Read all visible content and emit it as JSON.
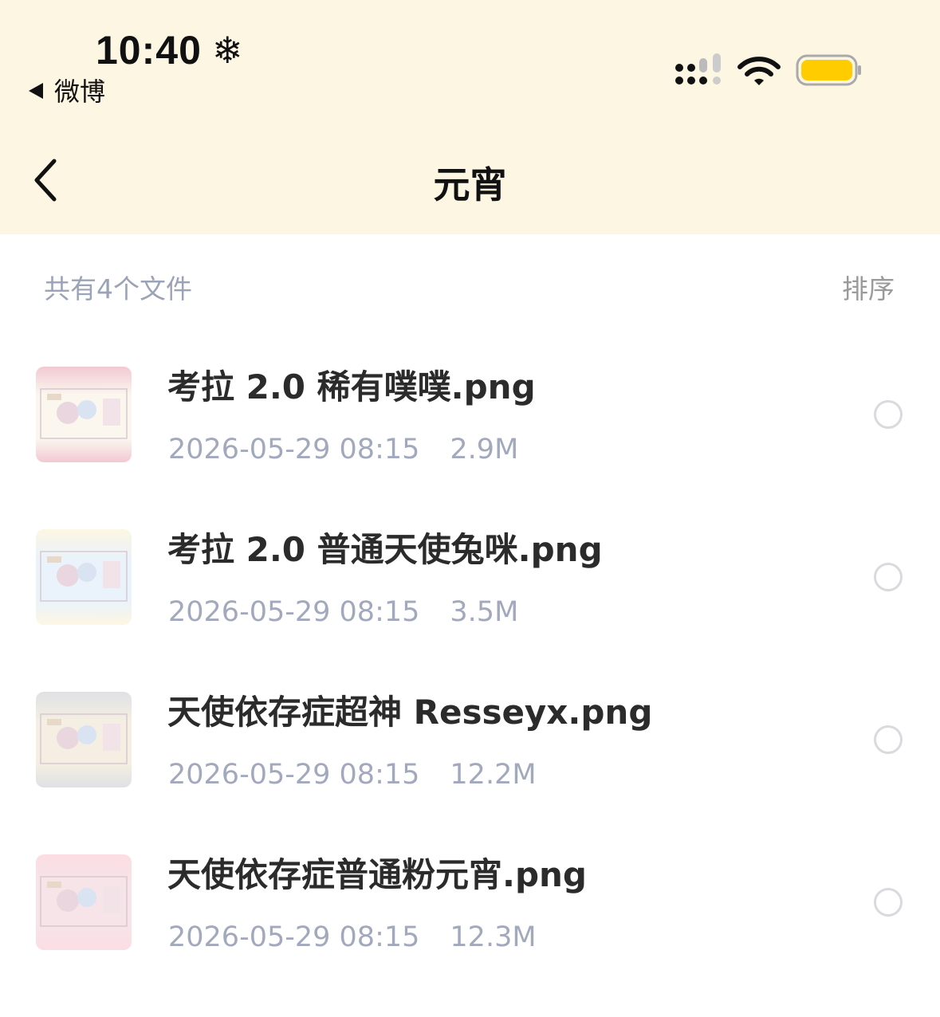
{
  "status_bar": {
    "time": "10:40",
    "weather_symbol": "❄",
    "back_app_label": "微博",
    "signal_icon": "signal-icon",
    "wifi_icon": "wifi-icon",
    "battery_icon": "battery-icon",
    "battery_color": "#ffcc00"
  },
  "header": {
    "title": "元宵",
    "back_icon": "chevron-left-icon",
    "background_color": "#fdf6e3"
  },
  "toolbar": {
    "summary": "共有4个文件",
    "sort_label": "排序"
  },
  "files": [
    {
      "name": "考拉 2.0 稀有噗噗.png",
      "date": "2026-05-29 08:15",
      "size": "2.9M",
      "thumb_color": "#fbf7ef",
      "thumb_accent": "#f2c9d3"
    },
    {
      "name": "考拉 2.0 普通天使兔咪.png",
      "date": "2026-05-29 08:15",
      "size": "3.5M",
      "thumb_color": "#eaf3fb",
      "thumb_accent": "#fdf6e3"
    },
    {
      "name": "天使依存症超神 Resseyx.png",
      "date": "2026-05-29 08:15",
      "size": "12.2M",
      "thumb_color": "#f4efe2",
      "thumb_accent": "#e0e0e4"
    },
    {
      "name": "天使依存症普通粉元宵.png",
      "date": "2026-05-29 08:15",
      "size": "12.3M",
      "thumb_color": "#f7e4e8",
      "thumb_accent": "#fbdde3"
    }
  ]
}
